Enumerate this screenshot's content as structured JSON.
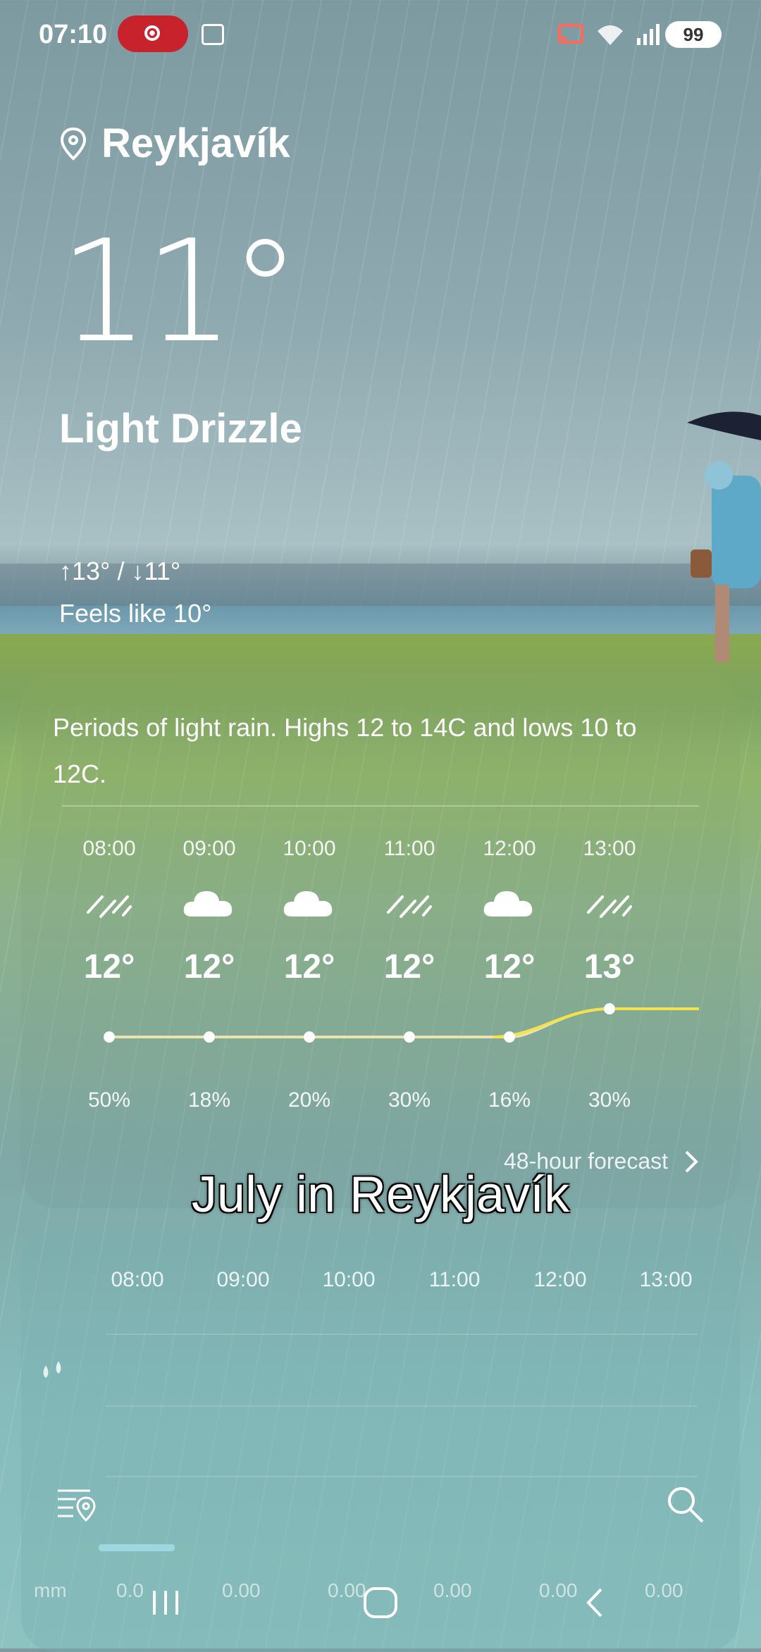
{
  "status": {
    "time": "07:10",
    "battery": "99"
  },
  "location": {
    "city": "Reykjavík"
  },
  "current": {
    "temp": "11°",
    "condition": "Light Drizzle",
    "hilo": "↑13° / ↓11°",
    "feels_like": "Feels like 10°"
  },
  "summary": "Periods of light rain. Highs 12 to 14C and lows 10 to 12C.",
  "hourly": [
    {
      "time": "08:00",
      "icon": "drizzle-icon",
      "temp": "12°",
      "precip": "50%"
    },
    {
      "time": "09:00",
      "icon": "cloud-icon",
      "temp": "12°",
      "precip": "18%"
    },
    {
      "time": "10:00",
      "icon": "cloud-icon",
      "temp": "12°",
      "precip": "20%"
    },
    {
      "time": "11:00",
      "icon": "drizzle-icon",
      "temp": "12°",
      "precip": "30%"
    },
    {
      "time": "12:00",
      "icon": "cloud-icon",
      "temp": "12°",
      "precip": "16%"
    },
    {
      "time": "13:00",
      "icon": "drizzle-icon",
      "temp": "13°",
      "precip": "30%"
    }
  ],
  "forecast_link": "48-hour forecast",
  "caption": "July in Reykjavík",
  "precip_card": {
    "times": [
      "08:00",
      "09:00",
      "10:00",
      "11:00",
      "12:00",
      "13:00"
    ],
    "unit": "mm",
    "amounts": [
      "0.0",
      "0.00",
      "0.00",
      "0.00",
      "0.00",
      "0.00"
    ]
  },
  "colors": {
    "temp_line": "#f2e34a",
    "temp_line_flat": "#e8e3b0"
  }
}
